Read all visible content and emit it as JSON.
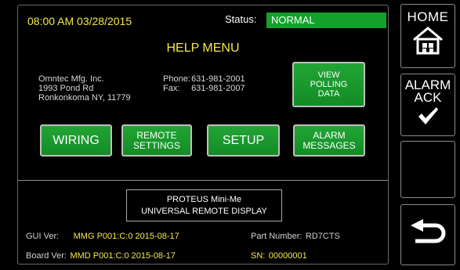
{
  "header": {
    "datetime": "08:00 AM 03/28/2015",
    "status_label": "Status:",
    "status_value": "NORMAL"
  },
  "title": "HELP MENU",
  "company": {
    "name": "Omntec Mfg. Inc.",
    "address1": "1993 Pond Rd",
    "address2": "Ronkonkoma NY, 11779"
  },
  "contact": {
    "phone_label": "Phone:",
    "phone": "631-981-2001",
    "fax_label": "Fax:",
    "fax": "631-981-2007"
  },
  "buttons": {
    "view_polling": [
      "VIEW",
      "POLLING",
      "DATA"
    ],
    "wiring": "WIRING",
    "remote_settings": [
      "REMOTE",
      "SETTINGS"
    ],
    "setup": "SETUP",
    "alarm_messages": [
      "ALARM",
      "MESSAGES"
    ]
  },
  "product": {
    "line1": "PROTEUS Mini-Me",
    "line2": "UNIVERSAL REMOTE DISPLAY"
  },
  "versions": {
    "gui_label": "GUI Ver:",
    "gui_value": "MMG P001:C:0 2015-08-17",
    "board_label": "Board Ver:",
    "board_value": "MMD P001:C:0 2015-08-17",
    "part_label": "Part Number:",
    "part_value": "RD7CTS",
    "sn_label": "SN:",
    "sn_value": "00000001"
  },
  "sidebar": {
    "home": "HOME",
    "alarm_ack": [
      "ALARM",
      "ACK"
    ]
  },
  "colors": {
    "green": "#13a12b",
    "yellow": "#f3e84a"
  },
  "icons": [
    "house-icon",
    "checkmark-icon",
    "return-arrow-icon"
  ]
}
